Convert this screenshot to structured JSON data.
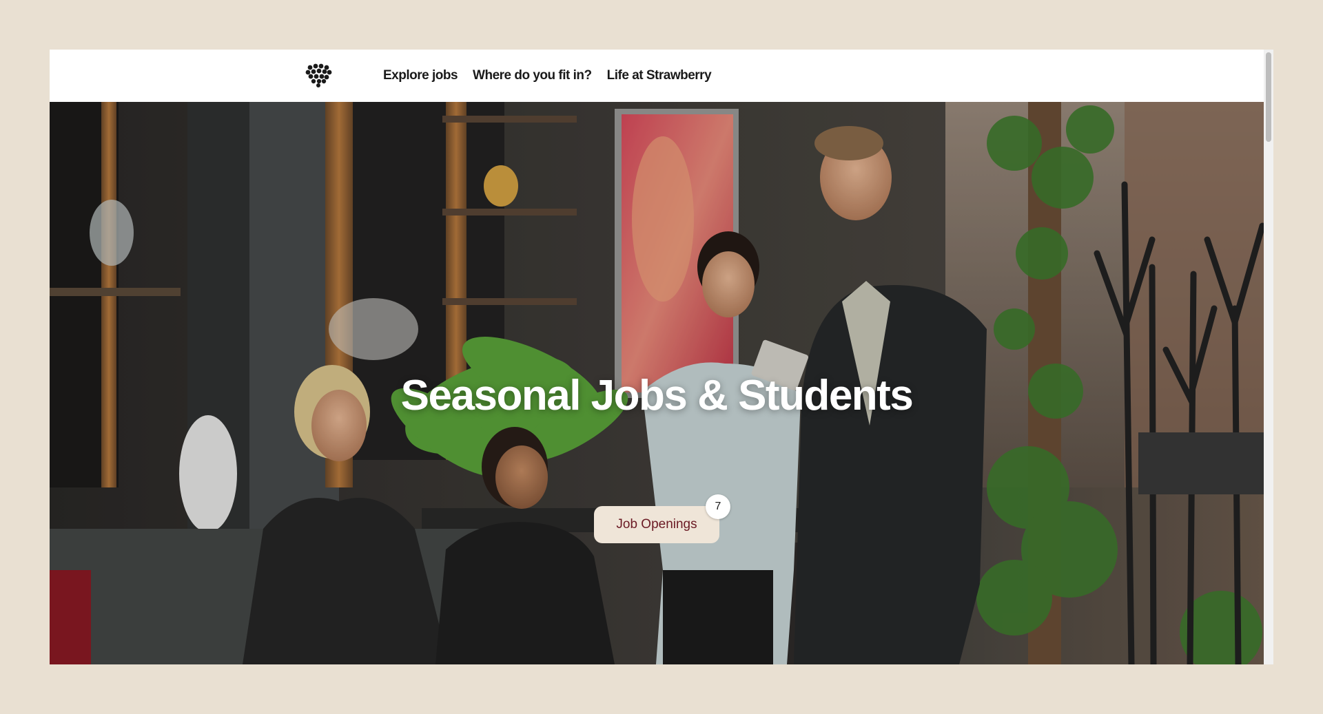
{
  "nav": {
    "logo_icon": "strawberry-logo-icon",
    "links": [
      "Explore jobs",
      "Where do you fit in?",
      "Life at Strawberry"
    ]
  },
  "hero": {
    "title": "Seasonal Jobs & Students",
    "button_label": "Job Openings",
    "openings_count": "7"
  },
  "colors": {
    "page_background": "#e9e0d2",
    "button_background": "#efe5d8",
    "button_text": "#6b1a24",
    "title_text": "#ffffff"
  }
}
